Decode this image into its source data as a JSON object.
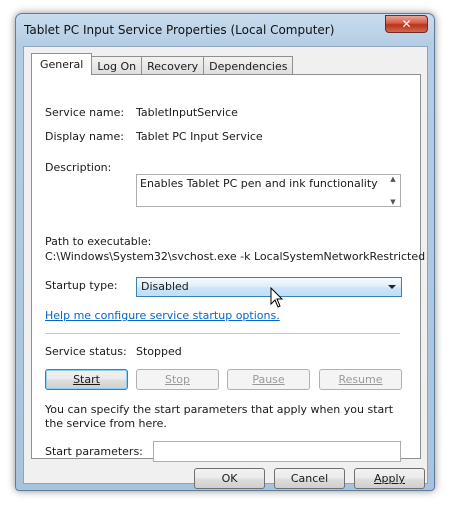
{
  "window": {
    "title": "Tablet PC Input Service Properties (Local Computer)",
    "close_glyph": "✕"
  },
  "tabs": [
    {
      "label": "General",
      "active": true
    },
    {
      "label": "Log On",
      "active": false
    },
    {
      "label": "Recovery",
      "active": false
    },
    {
      "label": "Dependencies",
      "active": false
    }
  ],
  "general": {
    "service_name_label": "Service name:",
    "service_name_value": "TabletInputService",
    "display_name_label": "Display name:",
    "display_name_value": "Tablet PC Input Service",
    "description_label": "Description:",
    "description_value": "Enables Tablet PC pen and ink functionality",
    "path_label": "Path to executable:",
    "path_value": "C:\\Windows\\System32\\svchost.exe -k LocalSystemNetworkRestricted",
    "startup_type_label": "Startup type:",
    "startup_type_value": "Disabled",
    "help_link": "Help me configure service startup options.",
    "service_status_label": "Service status:",
    "service_status_value": "Stopped",
    "start_params_text": "You can specify the start parameters that apply when you start the service from here.",
    "start_params_label": "Start parameters:",
    "start_params_value": ""
  },
  "service_buttons": {
    "start": "Start",
    "stop": "Stop",
    "pause": "Pause",
    "resume": "Resume"
  },
  "dialog_buttons": {
    "ok": "OK",
    "cancel": "Cancel",
    "apply": "Apply"
  },
  "colors": {
    "link": "#0066cc",
    "focus_border": "#3c7fb1"
  }
}
